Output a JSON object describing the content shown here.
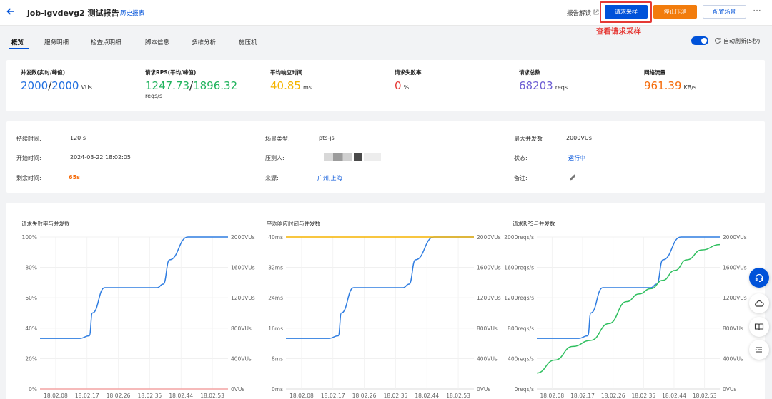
{
  "header": {
    "title": "job-igvdevg2 测试报告",
    "history_link": "历史报表",
    "report_explain": "报告解读",
    "request_sample": "请求采样",
    "stop_test": "停止压测",
    "config_scene": "配置场景",
    "more": "···",
    "highlight_note": "查看请求采样"
  },
  "tabs": [
    "概览",
    "服务明细",
    "检查点明细",
    "脚本信息",
    "多维分析",
    "施压机"
  ],
  "auto_refresh": {
    "label": "自动刷新(5秒)",
    "enabled": true
  },
  "metrics": [
    {
      "label": "并发数(实时/峰值)",
      "value_a": "2000",
      "sep": "/",
      "value_b": "2000",
      "unit": "VUs",
      "sub": ""
    },
    {
      "label": "请求RPS(平均/峰值)",
      "value_a": "1247.73",
      "sep": "/",
      "value_b": "1896.32",
      "unit": "",
      "sub": "reqs/s"
    },
    {
      "label": "平均响应时间",
      "value_a": "40.85",
      "sep": "",
      "value_b": "",
      "unit": "ms",
      "sub": ""
    },
    {
      "label": "请求失败率",
      "value_a": "0",
      "sep": "",
      "value_b": "",
      "unit": "%",
      "sub": ""
    },
    {
      "label": "请求总数",
      "value_a": "68203",
      "sep": "",
      "value_b": "",
      "unit": "reqs",
      "sub": ""
    },
    {
      "label": "网络流量",
      "value_a": "961.39",
      "sep": "",
      "value_b": "",
      "unit": "KB/s",
      "sub": ""
    }
  ],
  "info": {
    "duration": {
      "k": "持续时间:",
      "v": "120 s"
    },
    "start": {
      "k": "开始时间:",
      "v": "2024-03-22 18:02:05"
    },
    "remaining": {
      "k": "剩余时间:",
      "v": "65s"
    },
    "scene_type": {
      "k": "场景类型:",
      "v": "pts-js"
    },
    "tester": {
      "k": "压测人:",
      "v": ""
    },
    "source": {
      "k": "来源:",
      "v": "广州,上海"
    },
    "max_concurrency": {
      "k": "最大并发数",
      "v": "2000VUs"
    },
    "status": {
      "k": "状态:",
      "v": "运行中"
    },
    "remark": {
      "k": "备注:",
      "v": ""
    }
  },
  "colors": {
    "primary": "#0052d9",
    "warn": "#f27c0c",
    "series_blue": "#2f7de1",
    "series_green": "#2fbf5f",
    "series_yellow": "#f5b400",
    "series_red": "#f4a3a3"
  },
  "chart_data": [
    {
      "type": "line",
      "title": "请求失败率与并发数",
      "x": [
        "18:02:08",
        "18:02:17",
        "18:02:26",
        "18:02:35",
        "18:02:44",
        "18:02:53"
      ],
      "y_left_ticks": [
        "100%",
        "80%",
        "60%",
        "40%",
        "20%",
        "0%"
      ],
      "y_right_ticks": [
        "2000VUs",
        "1600VUs",
        "1200VUs",
        "800VUs",
        "400VUs",
        "0VUs"
      ],
      "series": [
        {
          "name": "",
          "axis": "right",
          "color": "#2f7de1",
          "t": [
            0,
            13,
            16,
            17,
            21,
            27,
            38,
            40,
            42,
            48,
            52,
            61
          ],
          "values": [
            666,
            666,
            700,
            1000,
            1333,
            1333,
            1333,
            1380,
            1700,
            2000,
            2000,
            2000
          ]
        },
        {
          "name": "",
          "axis": "left",
          "color": "#f4a3a3",
          "t": [
            0,
            61
          ],
          "values": [
            0,
            0
          ]
        }
      ],
      "y_left_range": [
        0,
        100
      ],
      "y_right_range": [
        0,
        2000
      ],
      "t_range": [
        0,
        61
      ],
      "grid": true
    },
    {
      "type": "line",
      "title": "平均响应时间与并发数",
      "x": [
        "18:02:08",
        "18:02:17",
        "18:02:26",
        "18:02:35",
        "18:02:44",
        "18:02:53"
      ],
      "y_left_ticks": [
        "40ms",
        "32ms",
        "24ms",
        "16ms",
        "8ms",
        "0ms"
      ],
      "y_right_ticks": [
        "2000VUs",
        "1600VUs",
        "1200VUs",
        "800VUs",
        "400VUs",
        "0VUs"
      ],
      "series": [
        {
          "name": "",
          "axis": "right",
          "color": "#2f7de1",
          "t": [
            0,
            14,
            17,
            18,
            22,
            36,
            38,
            40,
            42,
            48,
            52,
            61
          ],
          "values": [
            666,
            666,
            700,
            1000,
            1333,
            1333,
            1333,
            1380,
            1700,
            2000,
            2000,
            2000
          ]
        },
        {
          "name": "",
          "axis": "left",
          "color": "#f5b400",
          "t": [
            0,
            61
          ],
          "values": [
            40,
            40
          ]
        }
      ],
      "y_left_range": [
        0,
        40
      ],
      "y_right_range": [
        0,
        2000
      ],
      "t_range": [
        0,
        61
      ],
      "grid": true
    },
    {
      "type": "line",
      "title": "请求RPS与并发数",
      "x": [
        "18:02:08",
        "18:02:17",
        "18:02:26",
        "18:02:35",
        "18:02:44",
        "18:02:53"
      ],
      "y_left_ticks": [
        "2000reqs/s",
        "1600reqs/s",
        "1200reqs/s",
        "800reqs/s",
        "400reqs/s",
        "0reqs/s"
      ],
      "y_right_ticks": [
        "2000VUs",
        "1600VUs",
        "1200VUs",
        "800VUs",
        "400VUs",
        "0VUs"
      ],
      "series": [
        {
          "name": "",
          "axis": "right",
          "color": "#2f7de1",
          "t": [
            0,
            14,
            17,
            18,
            22,
            36,
            38,
            40,
            42,
            48,
            52,
            61
          ],
          "values": [
            666,
            666,
            700,
            1000,
            1333,
            1333,
            1333,
            1380,
            1700,
            2000,
            2000,
            2000
          ]
        },
        {
          "name": "",
          "axis": "left",
          "color": "#2fbf5f",
          "t": [
            0,
            6,
            12,
            18,
            24,
            30,
            34,
            38,
            42,
            46,
            50,
            55,
            61
          ],
          "values": [
            210,
            380,
            560,
            640,
            860,
            1150,
            1250,
            1320,
            1430,
            1560,
            1700,
            1830,
            1900
          ]
        }
      ],
      "y_left_range": [
        0,
        2000
      ],
      "y_right_range": [
        0,
        2000
      ],
      "t_range": [
        0,
        61
      ],
      "grid": true
    }
  ]
}
